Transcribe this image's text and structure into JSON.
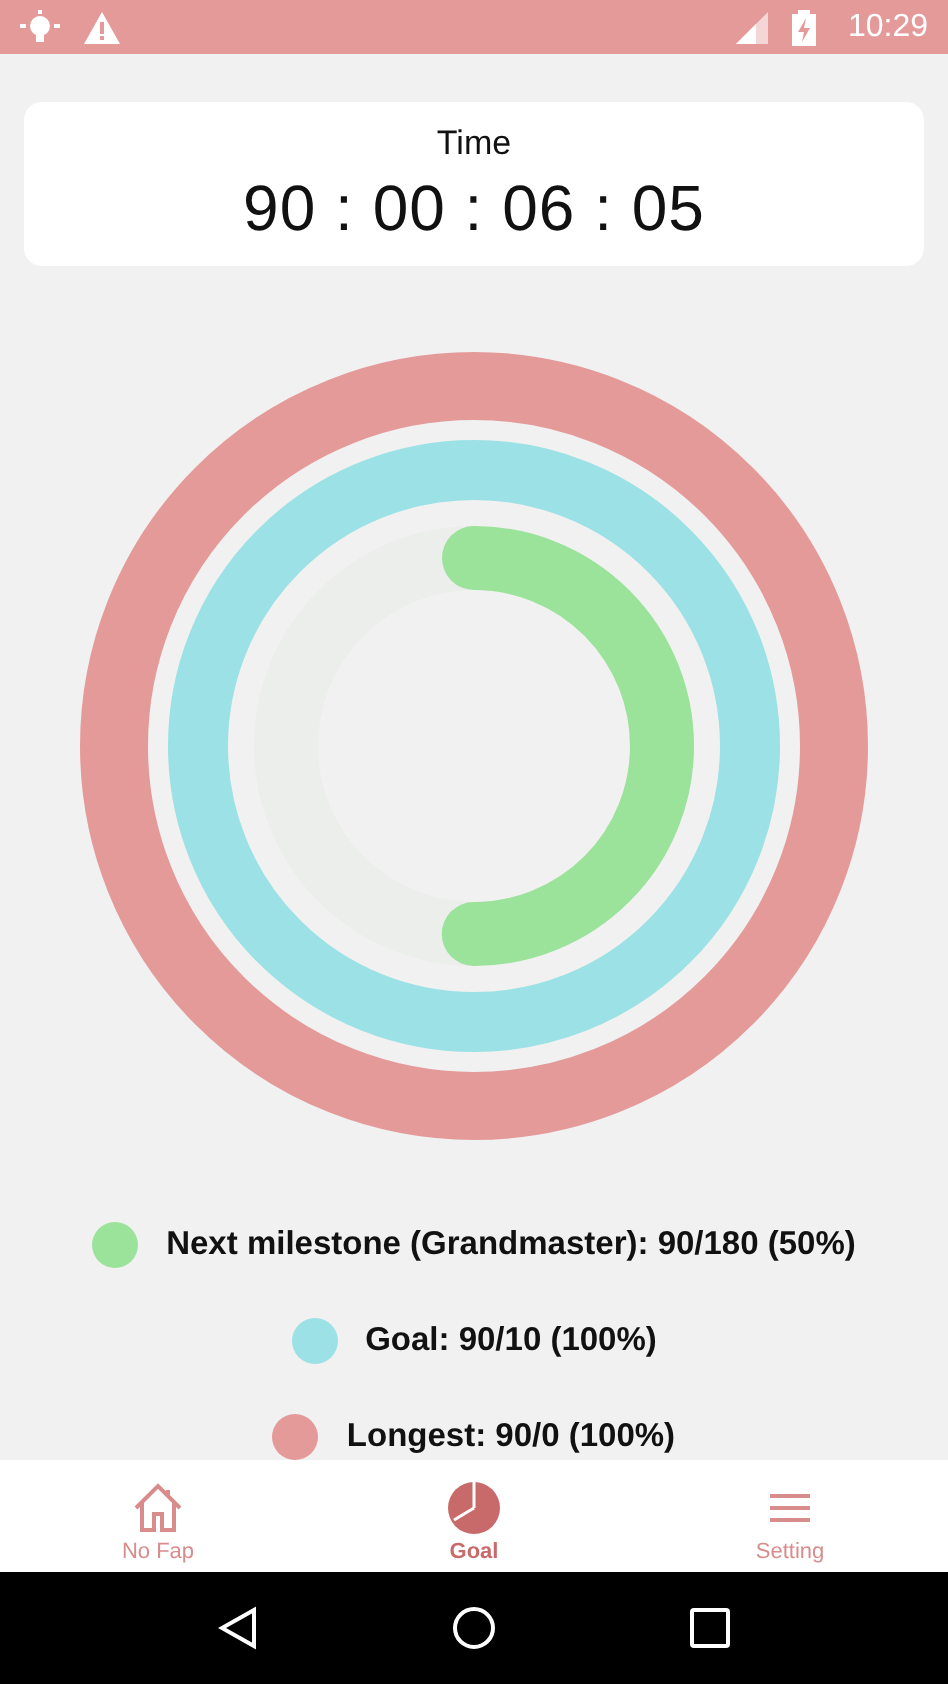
{
  "status_bar": {
    "time": "10:29"
  },
  "timer": {
    "label": "Time",
    "value": "90 : 00 : 06 : 05"
  },
  "rings": [
    {
      "color": "#e59a9a",
      "level": 1
    },
    {
      "color": "#9be1e5",
      "level": 1
    },
    {
      "color": "#9be29a",
      "level": 0.5
    }
  ],
  "legend": [
    {
      "text": "Next milestone (Grandmaster): 90/180 (50%)",
      "color": "#9be29a"
    },
    {
      "text": "Goal: 90/10 (100%)",
      "color": "#9be1e5"
    },
    {
      "text": "Longest: 90/0 (100%)",
      "color": "#e59a9a"
    }
  ],
  "tabs": [
    {
      "label": "No Fap",
      "kind": "home",
      "selected": false
    },
    {
      "label": "Goal",
      "kind": "chart",
      "selected": true
    },
    {
      "label": "Setting",
      "kind": "menu",
      "selected": false
    }
  ]
}
